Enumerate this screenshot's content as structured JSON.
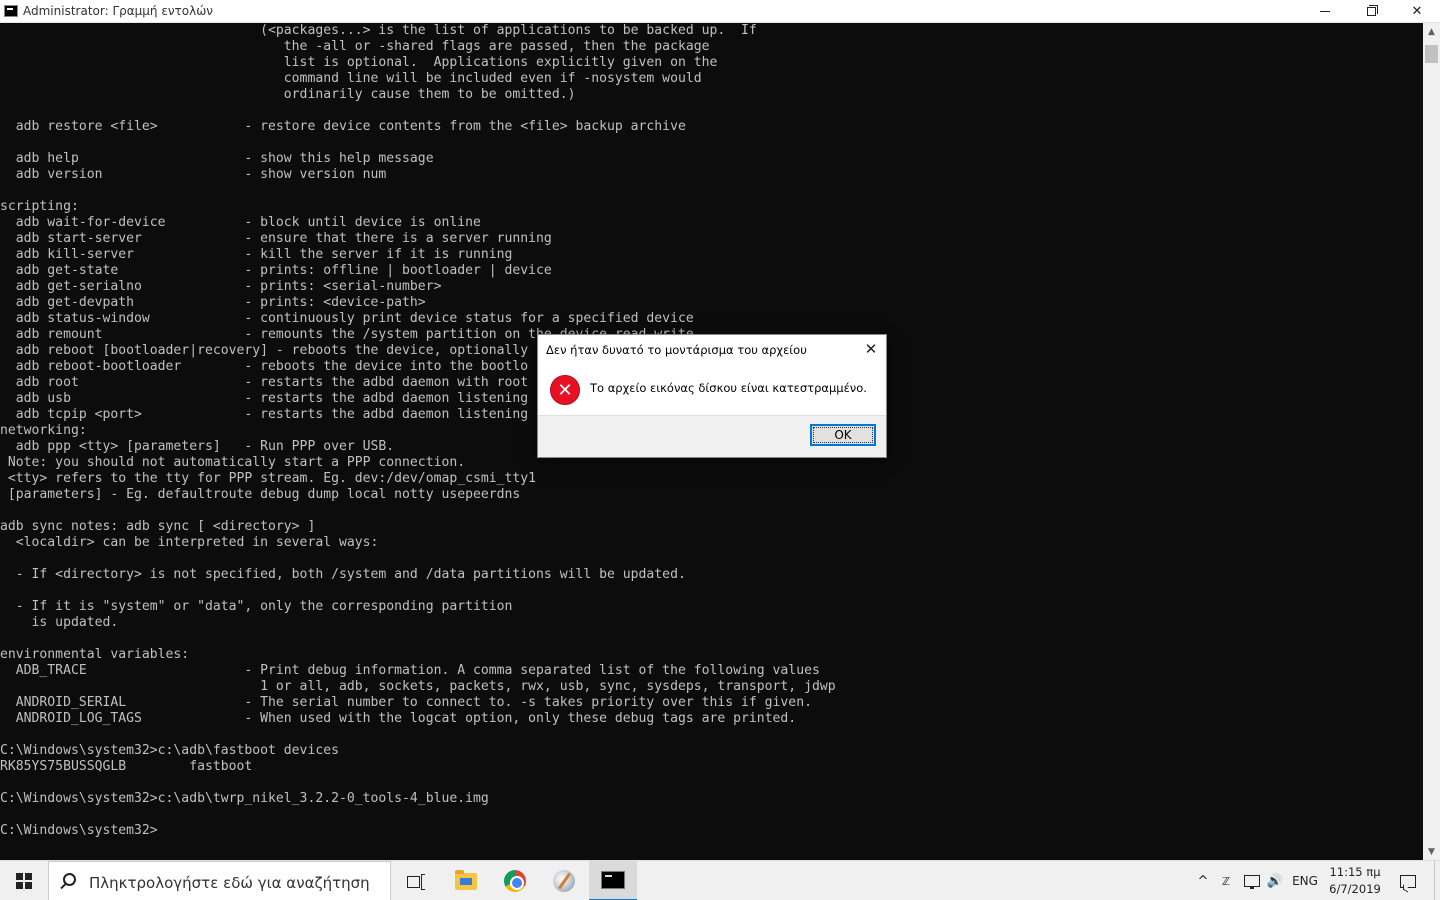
{
  "window": {
    "title": "Administrator: Γραμμή εντολών",
    "min_glyph": "",
    "close_glyph": "✕"
  },
  "console": {
    "lines": [
      "                                 (<packages...> is the list of applications to be backed up.  If",
      "                                    the -all or -shared flags are passed, then the package",
      "                                    list is optional.  Applications explicitly given on the",
      "                                    command line will be included even if -nosystem would",
      "                                    ordinarily cause them to be omitted.)",
      "",
      "  adb restore <file>           - restore device contents from the <file> backup archive",
      "",
      "  adb help                     - show this help message",
      "  adb version                  - show version num",
      "",
      "scripting:",
      "  adb wait-for-device          - block until device is online",
      "  adb start-server             - ensure that there is a server running",
      "  adb kill-server              - kill the server if it is running",
      "  adb get-state                - prints: offline | bootloader | device",
      "  adb get-serialno             - prints: <serial-number>",
      "  adb get-devpath              - prints: <device-path>",
      "  adb status-window            - continuously print device status for a specified device",
      "  adb remount                  - remounts the /system partition on the device read-write",
      "  adb reboot [bootloader|recovery] - reboots the device, optionally",
      "  adb reboot-bootloader        - reboots the device into the bootlo",
      "  adb root                     - restarts the adbd daemon with root",
      "  adb usb                      - restarts the adbd daemon listening",
      "  adb tcpip <port>             - restarts the adbd daemon listening",
      "networking:",
      "  adb ppp <tty> [parameters]   - Run PPP over USB.",
      " Note: you should not automatically start a PPP connection.",
      " <tty> refers to the tty for PPP stream. Eg. dev:/dev/omap_csmi_tty1",
      " [parameters] - Eg. defaultroute debug dump local notty usepeerdns",
      "",
      "adb sync notes: adb sync [ <directory> ]",
      "  <localdir> can be interpreted in several ways:",
      "",
      "  - If <directory> is not specified, both /system and /data partitions will be updated.",
      "",
      "  - If it is \"system\" or \"data\", only the corresponding partition",
      "    is updated.",
      "",
      "environmental variables:",
      "  ADB_TRACE                    - Print debug information. A comma separated list of the following values",
      "                                 1 or all, adb, sockets, packets, rwx, usb, sync, sysdeps, transport, jdwp",
      "  ANDROID_SERIAL               - The serial number to connect to. -s takes priority over this if given.",
      "  ANDROID_LOG_TAGS             - When used with the logcat option, only these debug tags are printed.",
      "",
      "C:\\Windows\\system32>c:\\adb\\fastboot devices",
      "RK85YS75BUSSQGLB        fastboot",
      "",
      "C:\\Windows\\system32>c:\\adb\\twrp_nikel_3.2.2-0_tools-4_blue.img",
      "",
      "C:\\Windows\\system32>"
    ]
  },
  "scrollbar": {
    "up_glyph": "▲",
    "down_glyph": "▼"
  },
  "dialog": {
    "title": "Δεν ήταν δυνατό το μοντάρισμα του αρχείου",
    "close_glyph": "✕",
    "error_glyph": "✕",
    "message": "Το αρχείο εικόνας δίσκου είναι κατεστραμμένο.",
    "ok_label": "OK"
  },
  "taskbar": {
    "search_placeholder": "Πληκτρολογήστε εδώ για αναζήτηση",
    "tray_chevron": "^",
    "tray_ime": "ℤ",
    "tray_volume": "🔊",
    "language": "ENG",
    "time": "11:15 πμ",
    "date": "6/7/2019"
  },
  "colors": {
    "console_bg": "#0c0c0c",
    "console_text": "#c0c0c0",
    "error_red": "#e81123",
    "focus_blue": "#0078d7"
  }
}
